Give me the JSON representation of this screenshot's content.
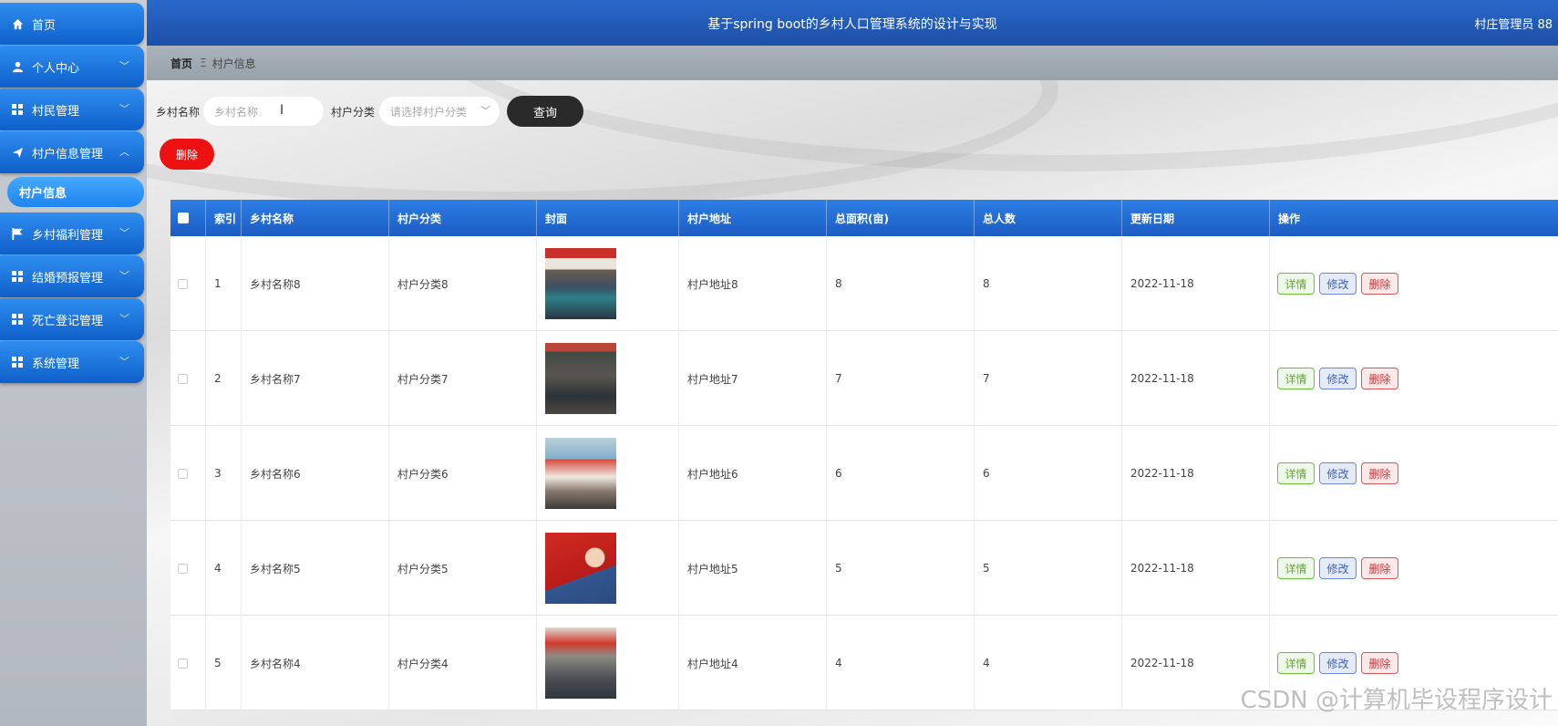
{
  "app": {
    "title": "基于spring boot的乡村人口管理系统的设计与实现",
    "user": "村庄管理员 88"
  },
  "sidebar": {
    "items": [
      {
        "label": "首页",
        "icon": "home-icon"
      },
      {
        "label": "个人中心",
        "icon": "user-icon"
      },
      {
        "label": "村民管理",
        "icon": "grid-icon"
      },
      {
        "label": "村户信息管理",
        "icon": "send-icon"
      },
      {
        "label": "乡村福利管理",
        "icon": "flag-icon"
      },
      {
        "label": "结婚预报管理",
        "icon": "grid-icon"
      },
      {
        "label": "死亡登记管理",
        "icon": "grid-icon"
      },
      {
        "label": "系统管理",
        "icon": "grid-icon"
      }
    ],
    "sub_item": "村户信息"
  },
  "breadcrumb": {
    "home": "首页",
    "separator": "Ξ",
    "current": "村户信息"
  },
  "search": {
    "name_label": "乡村名称",
    "name_placeholder": "乡村名称",
    "category_label": "村户分类",
    "category_placeholder": "请选择村户分类",
    "query_button": "查询",
    "delete_button": "删除"
  },
  "table": {
    "headers": [
      "索引",
      "乡村名称",
      "村户分类",
      "封面",
      "村户地址",
      "总面积(亩)",
      "总人数",
      "更新日期",
      "操作"
    ],
    "actions": {
      "detail": "详情",
      "edit": "修改",
      "delete": "删除"
    },
    "rows": [
      {
        "index": "1",
        "name": "乡村名称8",
        "category": "村户分类8",
        "address": "村户地址8",
        "area": "8",
        "people": "8",
        "date": "2022-11-18"
      },
      {
        "index": "2",
        "name": "乡村名称7",
        "category": "村户分类7",
        "address": "村户地址7",
        "area": "7",
        "people": "7",
        "date": "2022-11-18"
      },
      {
        "index": "3",
        "name": "乡村名称6",
        "category": "村户分类6",
        "address": "村户地址6",
        "area": "6",
        "people": "6",
        "date": "2022-11-18"
      },
      {
        "index": "4",
        "name": "乡村名称5",
        "category": "村户分类5",
        "address": "村户地址5",
        "area": "5",
        "people": "5",
        "date": "2022-11-18"
      },
      {
        "index": "5",
        "name": "乡村名称4",
        "category": "村户分类4",
        "address": "村户地址4",
        "area": "4",
        "people": "4",
        "date": "2022-11-18"
      }
    ]
  },
  "watermark": "CSDN @计算机毕设程序设计",
  "colors": {
    "menu_blue": "#1f78e0",
    "header_blue": "#2a69c9",
    "delete_red": "#ee1111",
    "query_dark": "#2a2a2a"
  }
}
